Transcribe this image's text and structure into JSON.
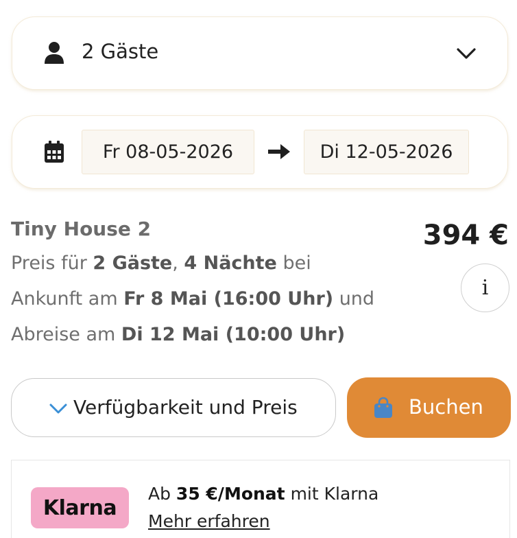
{
  "guests": {
    "label": "2 Gäste"
  },
  "dates": {
    "from": "Fr 08-05-2026",
    "to": "Di 12-05-2026"
  },
  "listing": {
    "title": "Tiny House 2",
    "price": "394 €",
    "desc_line1": {
      "pre": "Preis für ",
      "guests": "2 Gäste",
      "sep": ", ",
      "nights": "4 Nächte",
      "post": " bei"
    },
    "desc_line2": {
      "pre": "Ankunft am ",
      "arrival": "Fr 8 Mai (16:00 Uhr)",
      "post": " und"
    },
    "desc_line3": {
      "pre": "Abreise am ",
      "departure": "Di 12 Mai (10:00 Uhr)"
    },
    "info_label": "i"
  },
  "actions": {
    "availability_label": "Verfügbarkeit und Preis",
    "book_label": "Buchen"
  },
  "klarna": {
    "brand": "Klarna",
    "text_pre": "Ab ",
    "amount": "35 €/Monat",
    "text_post": " mit Klarna",
    "link": "Mehr erfahren"
  },
  "colors": {
    "accent": "#e08a36",
    "klarna_pink": "#f4a8c7",
    "chevron_blue": "#3a8fd6",
    "bag_blue": "#4a86c5"
  },
  "icons": [
    "person-icon",
    "chevron-down-icon",
    "calendar-icon",
    "arrow-right-icon",
    "info-icon",
    "bag-icon"
  ]
}
